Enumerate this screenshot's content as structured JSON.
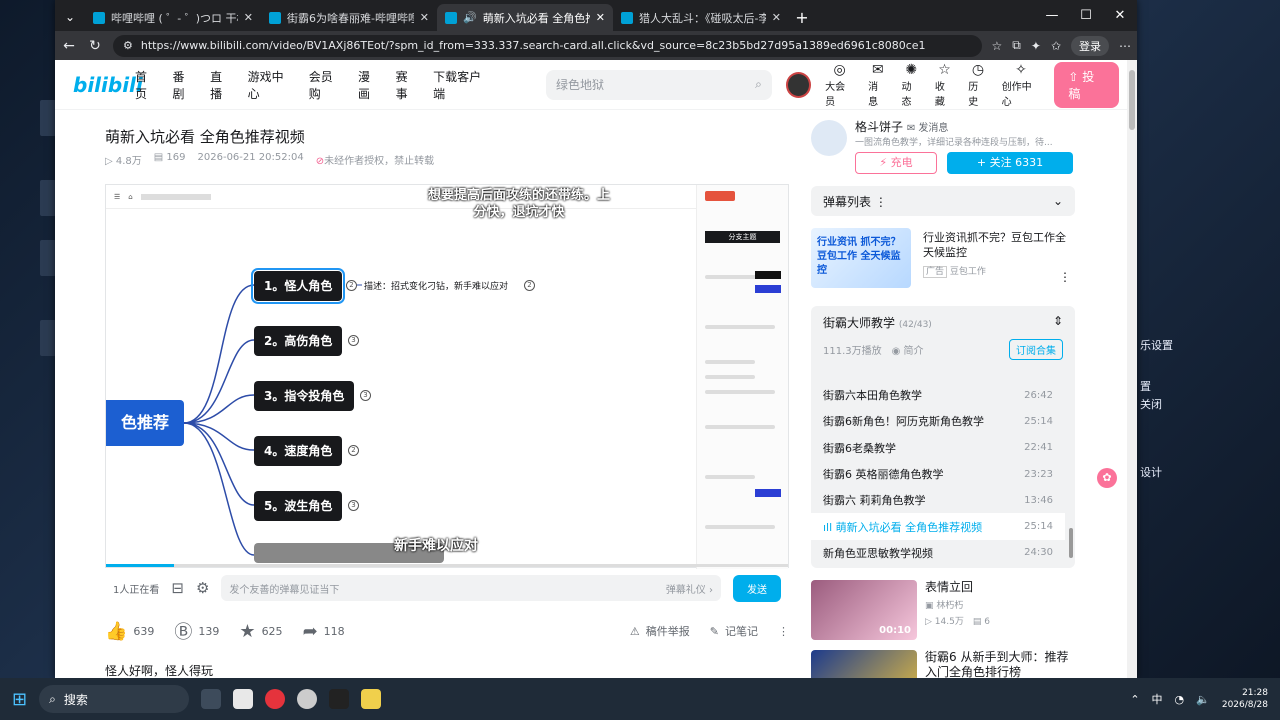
{
  "browser": {
    "tabs": [
      {
        "label": "哔哩哔哩 ( ゜- ゜)つロ 干杯~-bilibili",
        "active": false
      },
      {
        "label": "街霸6为啥春丽难-哔哩哔哩_bilibili",
        "active": false
      },
      {
        "label": "萌新入坑必看 全角色推荐视频",
        "active": true
      },
      {
        "label": "猎人大乱斗：《碰吸太后-李凭》",
        "active": false
      }
    ],
    "url": "https://www.bilibili.com/video/BV1AXj86TEot/?spm_id_from=333.337.search-card.all.click&vd_source=8c23b5bd27d95a1389ed6961c8080ce1",
    "login_label": "登录"
  },
  "header": {
    "logo": "bilibili",
    "nav": [
      "首页",
      "番剧",
      "直播",
      "游戏中心",
      "会员购",
      "漫画",
      "赛事",
      "下载客户端"
    ],
    "search_placeholder": "绿色地狱",
    "icons": [
      {
        "label": "大会员",
        "icon": "vip-icon"
      },
      {
        "label": "消息",
        "icon": "message-icon"
      },
      {
        "label": "动态",
        "icon": "dynamic-icon"
      },
      {
        "label": "收藏",
        "icon": "star-icon"
      },
      {
        "label": "历史",
        "icon": "clock-icon"
      },
      {
        "label": "创作中心",
        "icon": "bulb-icon"
      }
    ],
    "upload": "投稿"
  },
  "video": {
    "title": "萌新入坑必看 全角色推荐视频",
    "views": "4.8万",
    "danmaku": "169",
    "date": "2026-06-21 20:52:04",
    "copyright": "未经作者授权，禁止转载",
    "subtitle_top": "想要提高后面攻练的还带练。上分快，退坑才快",
    "subtitle_bottom": "新手难以应对",
    "mindmap": {
      "root": "色推荐",
      "nodes": [
        "1。怪人角色",
        "2。高伤角色",
        "3。指令投角色",
        "4。速度角色",
        "5。波生角色"
      ],
      "badges": [
        "2",
        "3",
        "3",
        "2",
        "3"
      ],
      "desc": "描述：招式变化刁钻，新手难以应对",
      "desc_badge": "2",
      "panel_title": "分支主题"
    }
  },
  "danmu": {
    "watching": "1人正在看",
    "placeholder": "发个友善的弹幕见证当下",
    "etiquette": "弹幕礼仪 ›",
    "send": "发送"
  },
  "actions": {
    "like": "639",
    "coin": "139",
    "fav": "625",
    "share": "118",
    "report": "稿件举报",
    "note": "记笔记"
  },
  "description": "怪人好啊，怪人得玩",
  "uploader": {
    "name": "格斗饼子",
    "msg": "发消息",
    "bio": "一图流角色教学，详细记录各种连段与压制，待...",
    "charge": "充电",
    "follow": "+ 关注 6331"
  },
  "danmaku_list": "弹幕列表",
  "ad": {
    "title": "行业资讯抓不完？豆包工作全天候监控",
    "tag": "广告",
    "source": "豆包工作",
    "img_text": "行业资讯 抓不完？ 豆包工作 全天候监控"
  },
  "collection": {
    "title": "街霸大师教学",
    "count": "(42/43)",
    "plays": "111.3万播放",
    "intro": "简介",
    "subscribe": "订阅合集",
    "episodes": [
      {
        "title": "街霸六本田角色教学",
        "duration": "26:42",
        "current": false
      },
      {
        "title": "街霸6新角色！阿历克斯角色教学",
        "duration": "25:14",
        "current": false
      },
      {
        "title": "街霸6老桑教学",
        "duration": "22:41",
        "current": false
      },
      {
        "title": "街霸6 英格丽德角色教学",
        "duration": "23:23",
        "current": false
      },
      {
        "title": "街霸六 莉莉角色教学",
        "duration": "13:46",
        "current": false
      },
      {
        "title": "萌新入坑必看 全角色推荐视频",
        "duration": "25:14",
        "current": true
      },
      {
        "title": "新角色亚思敏教学视频",
        "duration": "24:30",
        "current": false
      }
    ]
  },
  "recs": [
    {
      "title": "表情立回",
      "author": "林朽朽",
      "views": "14.5万",
      "comments": "6",
      "duration": "00:10"
    },
    {
      "title": "街霸6 从新手到大师：推荐入门全角色排行榜",
      "author": "",
      "views": "",
      "comments": "",
      "duration": ""
    }
  ],
  "desktop": {
    "right_items": [
      "乐设置",
      "置",
      "关闭",
      "设计"
    ]
  },
  "taskbar": {
    "search": "搜索",
    "lang": "中",
    "time": "21:28",
    "date": "2026/8/28"
  }
}
